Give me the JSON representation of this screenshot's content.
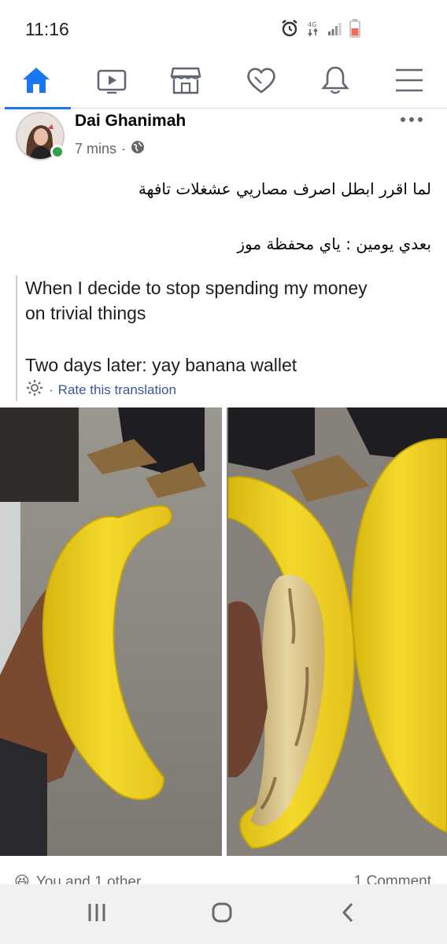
{
  "status_bar": {
    "time": "11:16"
  },
  "nav": {
    "items": [
      "home",
      "watch",
      "marketplace",
      "dating",
      "notifications",
      "menu"
    ]
  },
  "post": {
    "author": "Dai Ghanimah",
    "time": "7 mins",
    "separator": "·",
    "text_line1": "لما اقرر ابطل اصرف مصاريي عشغلات تافهة",
    "text_line2": "بعدي يومين : ياي محفظة موز",
    "translation": {
      "line1": "When I decide to stop spending my money",
      "line2": "on trivial things",
      "line3": "Two days later: yay banana wallet",
      "rate_dot": "·",
      "rate_label": "Rate this translation"
    },
    "reactions": {
      "emoji": "😆",
      "likes_text": "You and 1 other",
      "comments_text": "1 Comment"
    }
  },
  "colors": {
    "brand": "#1877f2",
    "online": "#31a24c",
    "banana": "#f2d32a"
  }
}
